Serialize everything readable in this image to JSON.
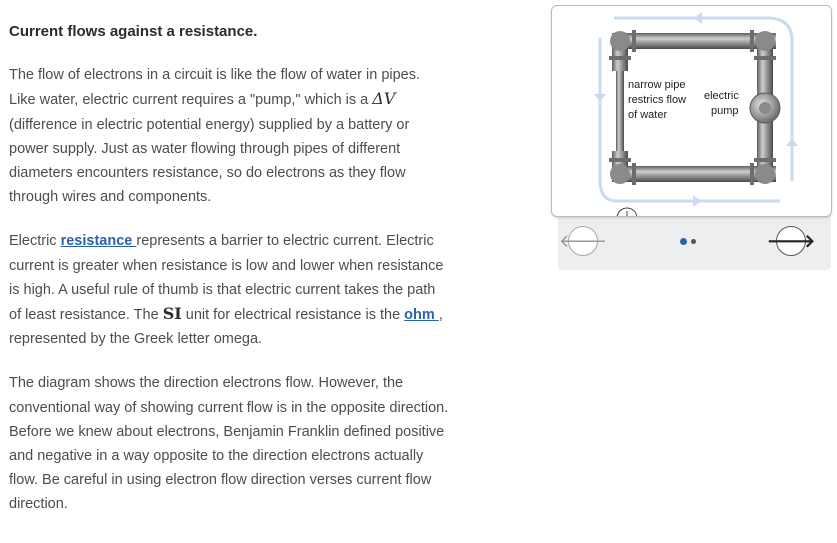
{
  "article": {
    "heading": "Current flows against a resistance.",
    "p1": {
      "before": "The flow of electrons in a circuit is like the flow of water in pipes. Like water, electric current requires a \"pump,\" which is a ",
      "math": "ΔV",
      "after": " (difference in electric potential energy) supplied by a battery or power supply. Just as water flowing through pipes of different diameters encounters resistance, so do electrons as they flow through wires and components."
    },
    "p2": {
      "before": "Electric ",
      "link1": "resistance ",
      "mid1": "represents a barrier to electric current. Electric current is greater when resistance is low and lower when resistance is high. A useful rule of thumb is that electric current takes the path of least resistance. The ",
      "math": "SI",
      "mid2": " unit for electrical resistance is the ",
      "link2": "ohm ",
      "after": ", represented by the Greek letter omega."
    },
    "p3": "The diagram shows the direction electrons flow. However, the conventional way of showing current flow is in the opposite direction. Before we knew about electrons, Benjamin Franklin defined positive and negative in a way opposite to the direction electrons actually flow. Be careful in using electron flow direction verses current flow direction."
  },
  "carousel": {
    "diagram": {
      "narrow_label": [
        "narrow pipe",
        "restrics flow",
        "of water"
      ],
      "pump_label": [
        "electric",
        "pump"
      ]
    },
    "prev_icon": "arrow-left-icon",
    "next_icon": "arrow-right-icon",
    "prev_glyph": "🡐",
    "next_glyph": "🡒",
    "slide_count": 2,
    "active_slide": 1,
    "colors": {
      "link": "#2a63ad",
      "flow_arrow": "#c9daf2",
      "pipe": "#7d7d7d"
    }
  }
}
